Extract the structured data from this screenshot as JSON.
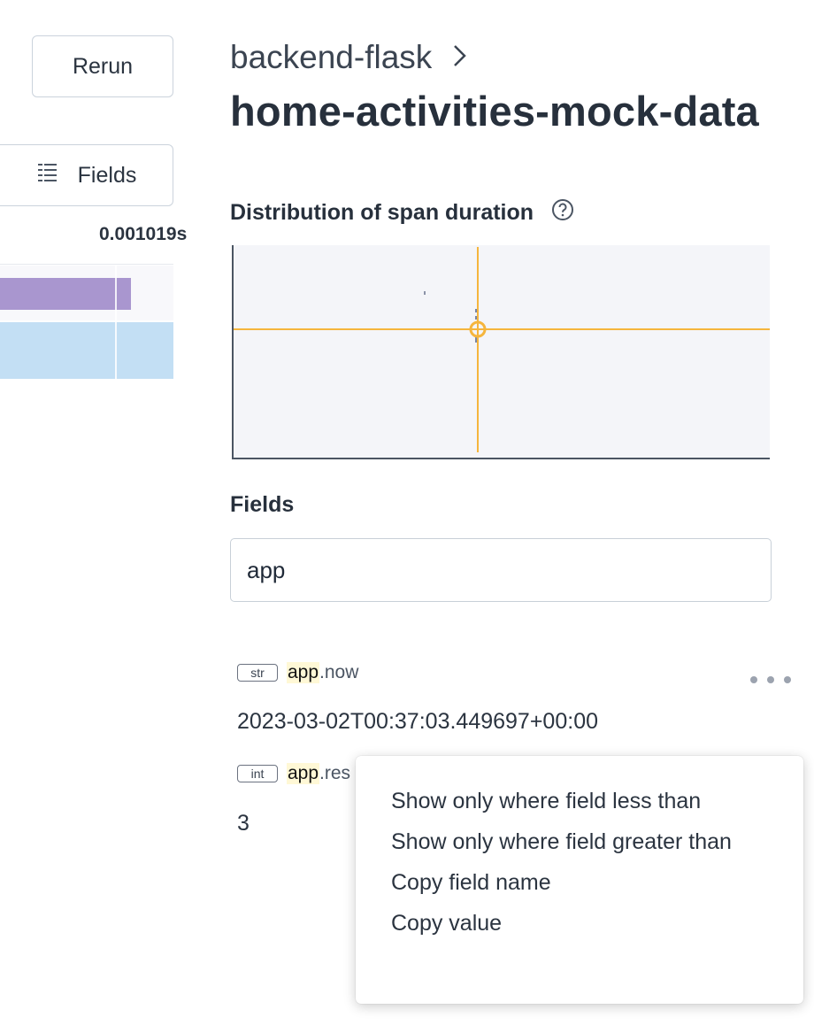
{
  "left_panel": {
    "rerun_label": "Rerun",
    "fields_label": "Fields",
    "duration": "0.001019s"
  },
  "breadcrumb": {
    "service": "backend-flask"
  },
  "title": "home-activities-mock-data",
  "distribution": {
    "label": "Distribution of span duration"
  },
  "fields": {
    "heading": "Fields",
    "search_value": "app",
    "items": [
      {
        "type": "str",
        "highlight": "app",
        "rest": ".now",
        "value": "2023-03-02T00:37:03.449697+00:00"
      },
      {
        "type": "int",
        "highlight": "app",
        "rest": ".res",
        "value": "3"
      }
    ]
  },
  "menu": {
    "items": [
      "Show only where field less than",
      "Show only where field greater than",
      "Copy field name",
      "Copy value"
    ]
  },
  "colors": {
    "crosshair": "#f5b53d",
    "trace_bar": "#a996cf",
    "selected_row": "#c3dff4",
    "highlight": "#fff8d6"
  }
}
